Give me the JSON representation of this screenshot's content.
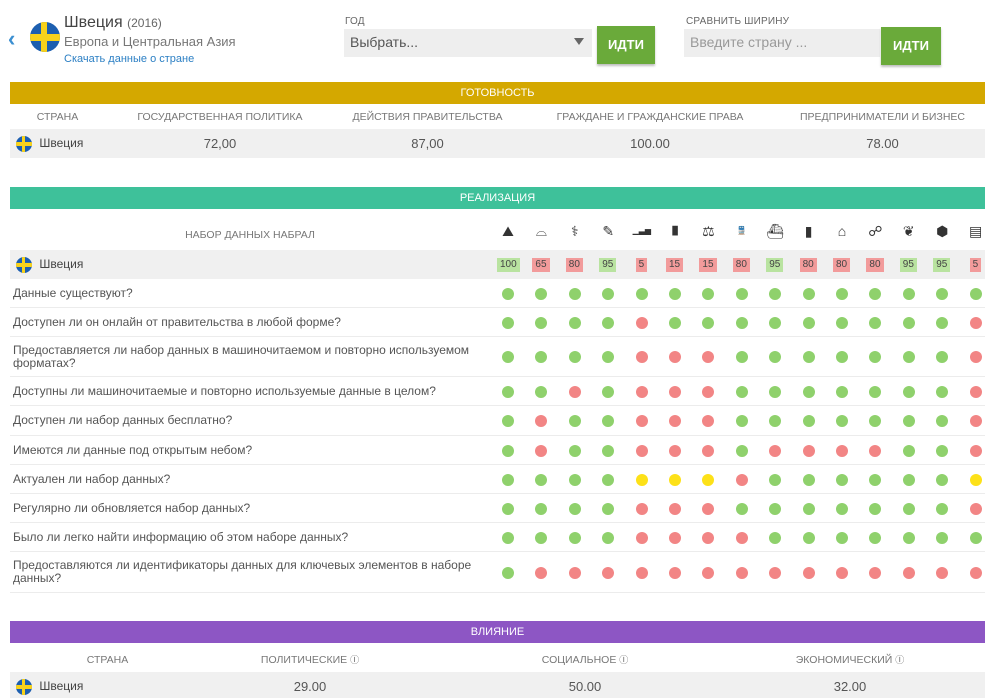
{
  "header": {
    "country": "Швеция",
    "year": "(2016)",
    "region": "Европа и Центральная Азия",
    "download_link": "Скачать данные о стране",
    "year_label": "ГОД",
    "year_select": "Выбрать...",
    "go_label": "ИДТИ",
    "compare_label": "СРАВНИТЬ ШИРИНУ",
    "compare_placeholder": "Введите страну ...",
    "go2_label": "ИДТИ"
  },
  "colors": {
    "readiness": "#d4a800",
    "implementation": "#3ec19a",
    "impact": "#8d56c4",
    "green": "#8fd16c",
    "red": "#f28585",
    "yellow": "#fde118",
    "score_green": "#b9e3a0",
    "score_red": "#f29b9b"
  },
  "readiness": {
    "title": "ГОТОВНОСТЬ",
    "headers": [
      "СТРАНА",
      "ГОСУДАРСТВЕННАЯ ПОЛИТИКА",
      "ДЕЙСТВИЯ ПРАВИТЕЛЬСТВА",
      "ГРАЖДАНЕ И ГРАЖДАНСКИЕ ПРАВА",
      "ПРЕДПРИНИМАТЕЛИ И БИЗНЕС"
    ],
    "country": "Швеция",
    "values": [
      "72,00",
      "87,00",
      "100.00",
      "78.00"
    ]
  },
  "implementation": {
    "title": "РЕАЛИЗАЦИЯ",
    "dataset_header": "НАБОР ДАННЫХ НАБРАЛ",
    "country": "Швеция",
    "icons": [
      "map-icon",
      "land-icon",
      "health-icon",
      "education-icon",
      "stats-icon",
      "budget-icon",
      "legislation-icon",
      "transport-icon",
      "trade-icon",
      "company-icon",
      "government-icon",
      "election-icon",
      "environment-icon",
      "contracts-icon",
      "spending-icon"
    ],
    "icon_glyphs": [
      "⛰",
      "⌓",
      "⚕",
      "✎",
      "▁▃▅",
      "▐▌",
      "⚖",
      "🚆",
      "⛴",
      "▮",
      "⌂",
      "☍",
      "❦",
      "⬢",
      "▤"
    ],
    "scores": [
      "100",
      "65",
      "80",
      "95",
      "5",
      "15",
      "15",
      "80",
      "95",
      "80",
      "80",
      "80",
      "95",
      "95",
      "5"
    ],
    "score_status": [
      "g",
      "r",
      "r",
      "g",
      "r",
      "r",
      "r",
      "r",
      "g",
      "r",
      "r",
      "r",
      "g",
      "g",
      "r"
    ],
    "questions": [
      {
        "text": "Данные существуют?",
        "dots": "ggggggggggggggg"
      },
      {
        "text": "Доступен ли он онлайн от правительства в любой форме?",
        "dots": "ggggrggggggggg r"
      },
      {
        "text": "Предоставляется ли набор данных в машиночитаемом и повторно используемом форматах?",
        "dots": "ggggrrrgggggggr"
      },
      {
        "text": "Доступны ли машиночитаемые и повторно используемые данные в целом?",
        "dots": "ggrgrrrgggggggr"
      },
      {
        "text": "Доступен ли набор данных бесплатно?",
        "dots": "grggrrrgggggggr"
      },
      {
        "text": "Имеются ли данные под открытым небом?",
        "dots": "grggrrrgrrrrggr"
      },
      {
        "text": "Актуален ли набор данных?",
        "dots": "ggggyyyrggggggy"
      },
      {
        "text": "Регулярно ли обновляется набор данных?",
        "dots": "ggggrrrgggggggr"
      },
      {
        "text": "Было ли легко найти информацию об этом наборе данных?",
        "dots": "ggggrrrrgggggggr"
      },
      {
        "text": "Предоставляются ли идентификаторы данных для ключевых элементов в наборе данных?",
        "dots": "grrrrrrrrrrrrrr"
      }
    ]
  },
  "impact": {
    "title": "ВЛИЯНИЕ",
    "headers": [
      "СТРАНА",
      "ПОЛИТИЧЕСКИЕ",
      "СОЦИАЛЬНОЕ",
      "ЭКОНОМИЧЕСКИЙ"
    ],
    "info_glyph": "ⓘ",
    "country": "Швеция",
    "values": [
      "29.00",
      "50.00",
      "32.00"
    ]
  }
}
